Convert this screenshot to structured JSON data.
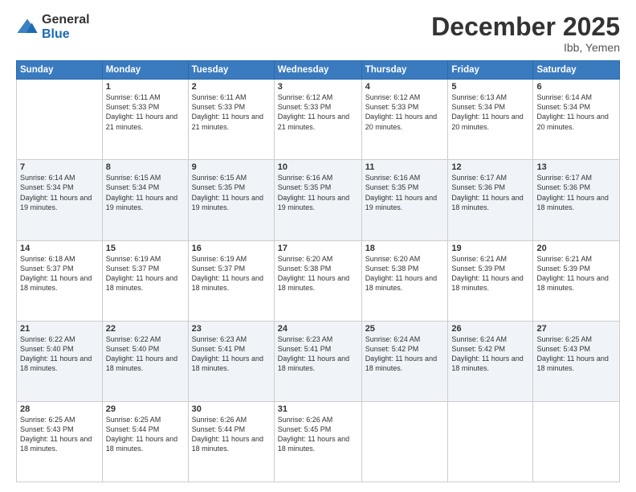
{
  "logo": {
    "general": "General",
    "blue": "Blue"
  },
  "header": {
    "month_title": "December 2025",
    "location": "Ibb, Yemen"
  },
  "days_of_week": [
    "Sunday",
    "Monday",
    "Tuesday",
    "Wednesday",
    "Thursday",
    "Friday",
    "Saturday"
  ],
  "weeks": [
    [
      {
        "day": "",
        "sunrise": "",
        "sunset": "",
        "daylight": ""
      },
      {
        "day": "1",
        "sunrise": "Sunrise: 6:11 AM",
        "sunset": "Sunset: 5:33 PM",
        "daylight": "Daylight: 11 hours and 21 minutes."
      },
      {
        "day": "2",
        "sunrise": "Sunrise: 6:11 AM",
        "sunset": "Sunset: 5:33 PM",
        "daylight": "Daylight: 11 hours and 21 minutes."
      },
      {
        "day": "3",
        "sunrise": "Sunrise: 6:12 AM",
        "sunset": "Sunset: 5:33 PM",
        "daylight": "Daylight: 11 hours and 21 minutes."
      },
      {
        "day": "4",
        "sunrise": "Sunrise: 6:12 AM",
        "sunset": "Sunset: 5:33 PM",
        "daylight": "Daylight: 11 hours and 20 minutes."
      },
      {
        "day": "5",
        "sunrise": "Sunrise: 6:13 AM",
        "sunset": "Sunset: 5:34 PM",
        "daylight": "Daylight: 11 hours and 20 minutes."
      },
      {
        "day": "6",
        "sunrise": "Sunrise: 6:14 AM",
        "sunset": "Sunset: 5:34 PM",
        "daylight": "Daylight: 11 hours and 20 minutes."
      }
    ],
    [
      {
        "day": "7",
        "sunrise": "Sunrise: 6:14 AM",
        "sunset": "Sunset: 5:34 PM",
        "daylight": "Daylight: 11 hours and 19 minutes."
      },
      {
        "day": "8",
        "sunrise": "Sunrise: 6:15 AM",
        "sunset": "Sunset: 5:34 PM",
        "daylight": "Daylight: 11 hours and 19 minutes."
      },
      {
        "day": "9",
        "sunrise": "Sunrise: 6:15 AM",
        "sunset": "Sunset: 5:35 PM",
        "daylight": "Daylight: 11 hours and 19 minutes."
      },
      {
        "day": "10",
        "sunrise": "Sunrise: 6:16 AM",
        "sunset": "Sunset: 5:35 PM",
        "daylight": "Daylight: 11 hours and 19 minutes."
      },
      {
        "day": "11",
        "sunrise": "Sunrise: 6:16 AM",
        "sunset": "Sunset: 5:35 PM",
        "daylight": "Daylight: 11 hours and 19 minutes."
      },
      {
        "day": "12",
        "sunrise": "Sunrise: 6:17 AM",
        "sunset": "Sunset: 5:36 PM",
        "daylight": "Daylight: 11 hours and 18 minutes."
      },
      {
        "day": "13",
        "sunrise": "Sunrise: 6:17 AM",
        "sunset": "Sunset: 5:36 PM",
        "daylight": "Daylight: 11 hours and 18 minutes."
      }
    ],
    [
      {
        "day": "14",
        "sunrise": "Sunrise: 6:18 AM",
        "sunset": "Sunset: 5:37 PM",
        "daylight": "Daylight: 11 hours and 18 minutes."
      },
      {
        "day": "15",
        "sunrise": "Sunrise: 6:19 AM",
        "sunset": "Sunset: 5:37 PM",
        "daylight": "Daylight: 11 hours and 18 minutes."
      },
      {
        "day": "16",
        "sunrise": "Sunrise: 6:19 AM",
        "sunset": "Sunset: 5:37 PM",
        "daylight": "Daylight: 11 hours and 18 minutes."
      },
      {
        "day": "17",
        "sunrise": "Sunrise: 6:20 AM",
        "sunset": "Sunset: 5:38 PM",
        "daylight": "Daylight: 11 hours and 18 minutes."
      },
      {
        "day": "18",
        "sunrise": "Sunrise: 6:20 AM",
        "sunset": "Sunset: 5:38 PM",
        "daylight": "Daylight: 11 hours and 18 minutes."
      },
      {
        "day": "19",
        "sunrise": "Sunrise: 6:21 AM",
        "sunset": "Sunset: 5:39 PM",
        "daylight": "Daylight: 11 hours and 18 minutes."
      },
      {
        "day": "20",
        "sunrise": "Sunrise: 6:21 AM",
        "sunset": "Sunset: 5:39 PM",
        "daylight": "Daylight: 11 hours and 18 minutes."
      }
    ],
    [
      {
        "day": "21",
        "sunrise": "Sunrise: 6:22 AM",
        "sunset": "Sunset: 5:40 PM",
        "daylight": "Daylight: 11 hours and 18 minutes."
      },
      {
        "day": "22",
        "sunrise": "Sunrise: 6:22 AM",
        "sunset": "Sunset: 5:40 PM",
        "daylight": "Daylight: 11 hours and 18 minutes."
      },
      {
        "day": "23",
        "sunrise": "Sunrise: 6:23 AM",
        "sunset": "Sunset: 5:41 PM",
        "daylight": "Daylight: 11 hours and 18 minutes."
      },
      {
        "day": "24",
        "sunrise": "Sunrise: 6:23 AM",
        "sunset": "Sunset: 5:41 PM",
        "daylight": "Daylight: 11 hours and 18 minutes."
      },
      {
        "day": "25",
        "sunrise": "Sunrise: 6:24 AM",
        "sunset": "Sunset: 5:42 PM",
        "daylight": "Daylight: 11 hours and 18 minutes."
      },
      {
        "day": "26",
        "sunrise": "Sunrise: 6:24 AM",
        "sunset": "Sunset: 5:42 PM",
        "daylight": "Daylight: 11 hours and 18 minutes."
      },
      {
        "day": "27",
        "sunrise": "Sunrise: 6:25 AM",
        "sunset": "Sunset: 5:43 PM",
        "daylight": "Daylight: 11 hours and 18 minutes."
      }
    ],
    [
      {
        "day": "28",
        "sunrise": "Sunrise: 6:25 AM",
        "sunset": "Sunset: 5:43 PM",
        "daylight": "Daylight: 11 hours and 18 minutes."
      },
      {
        "day": "29",
        "sunrise": "Sunrise: 6:25 AM",
        "sunset": "Sunset: 5:44 PM",
        "daylight": "Daylight: 11 hours and 18 minutes."
      },
      {
        "day": "30",
        "sunrise": "Sunrise: 6:26 AM",
        "sunset": "Sunset: 5:44 PM",
        "daylight": "Daylight: 11 hours and 18 minutes."
      },
      {
        "day": "31",
        "sunrise": "Sunrise: 6:26 AM",
        "sunset": "Sunset: 5:45 PM",
        "daylight": "Daylight: 11 hours and 18 minutes."
      },
      {
        "day": "",
        "sunrise": "",
        "sunset": "",
        "daylight": ""
      },
      {
        "day": "",
        "sunrise": "",
        "sunset": "",
        "daylight": ""
      },
      {
        "day": "",
        "sunrise": "",
        "sunset": "",
        "daylight": ""
      }
    ]
  ]
}
